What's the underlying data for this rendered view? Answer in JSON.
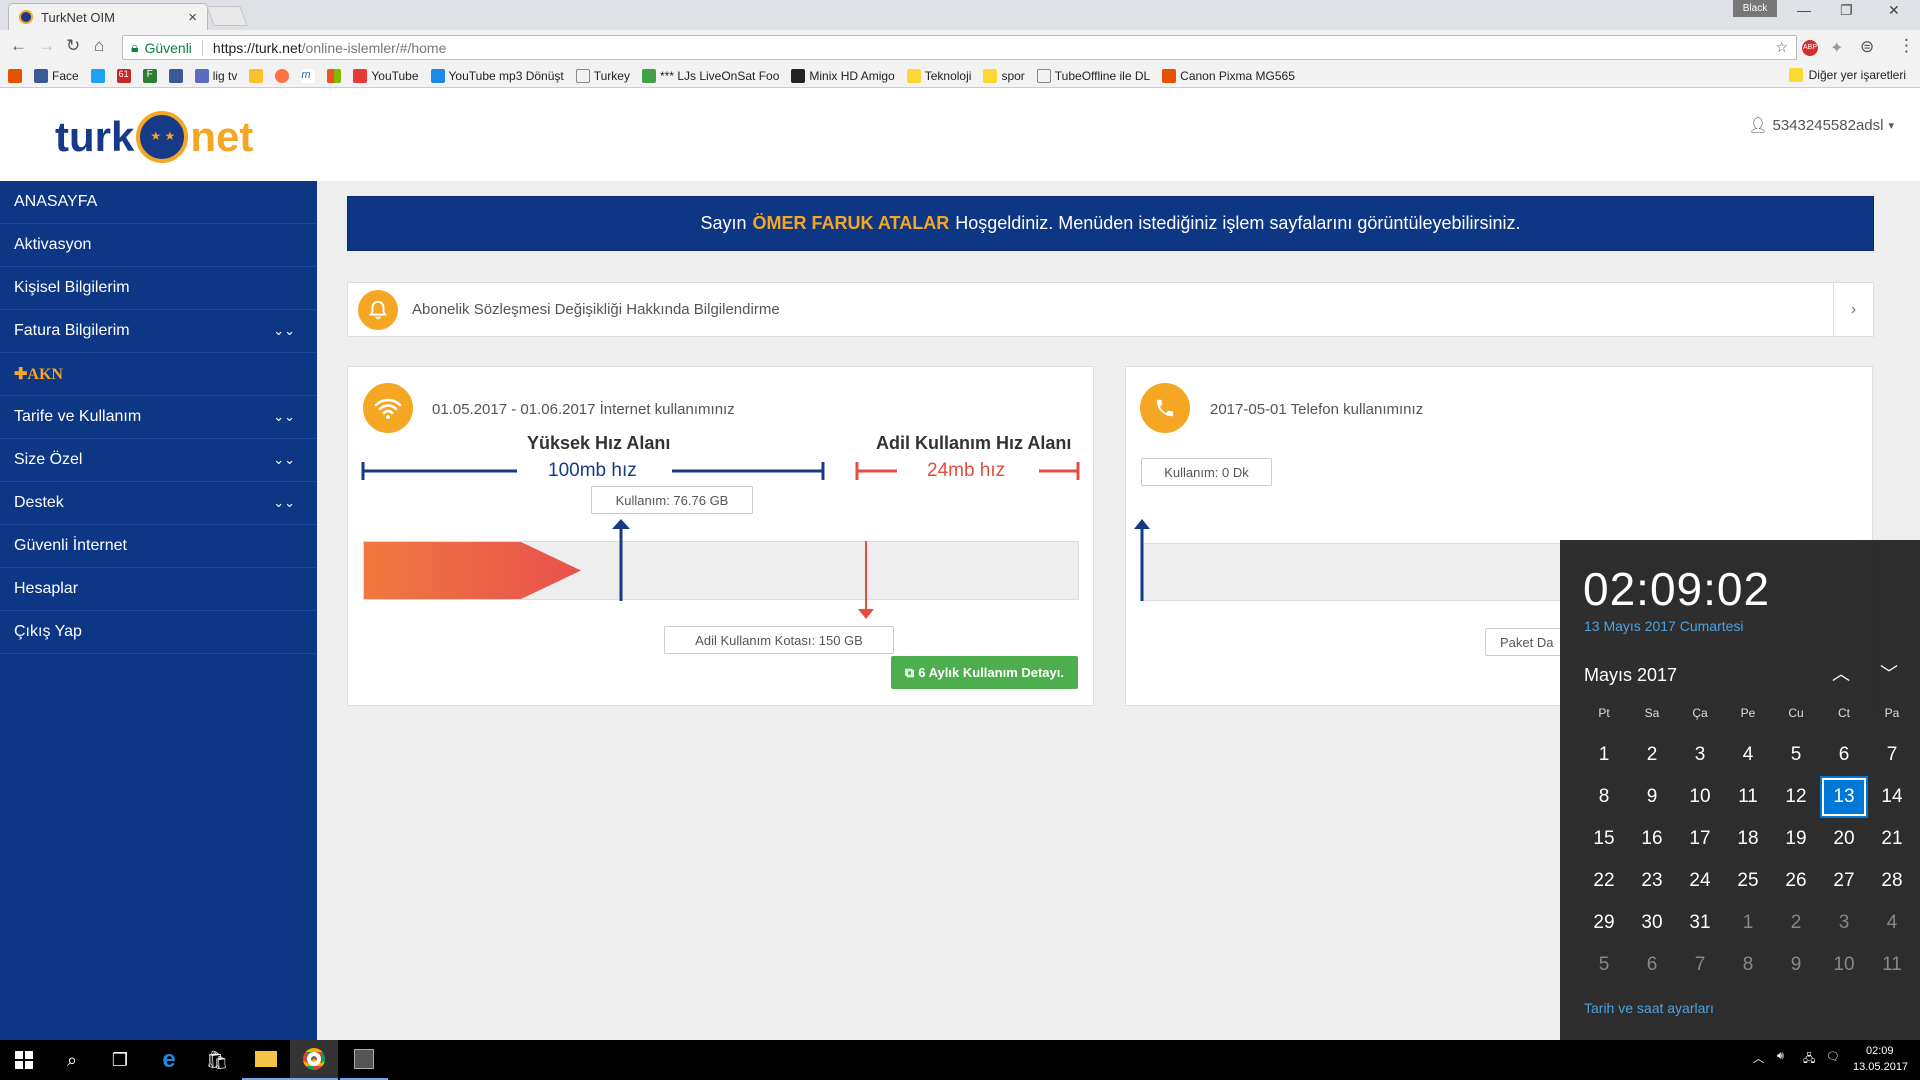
{
  "browser": {
    "tab_title": "TurkNet OIM",
    "profile": "Black",
    "security_label": "Güvenli",
    "url_domain": "https://turk.net",
    "url_path": "/online-islemler/#/home",
    "bookmarks": [
      "Face",
      "",
      "61",
      "F",
      "",
      "lig tv",
      "",
      "",
      "m",
      "",
      "YouTube",
      "YouTube mp3 Dönüşt",
      "Turkey",
      "*** LJs LiveOnSat Foo",
      "Minix HD Amigo",
      "Teknoloji",
      "spor",
      "TubeOffline ile DL",
      "Canon Pixma MG565"
    ],
    "other_bookmarks": "Diğer yer işaretleri"
  },
  "header": {
    "logo_left": "turk",
    "logo_right": "net",
    "username": "5343245582adsl"
  },
  "sidebar": {
    "items": [
      {
        "label": "ANASAYFA",
        "chevron": false
      },
      {
        "label": "Aktivasyon",
        "chevron": false
      },
      {
        "label": "Kişisel Bilgilerim",
        "chevron": false
      },
      {
        "label": "Fatura Bilgilerim",
        "chevron": true
      },
      {
        "label": "✚AKN",
        "chevron": false
      },
      {
        "label": "Tarife ve Kullanım",
        "chevron": true
      },
      {
        "label": "Size Özel",
        "chevron": true
      },
      {
        "label": "Destek",
        "chevron": true
      },
      {
        "label": "Güvenli İnternet",
        "chevron": false
      },
      {
        "label": "Hesaplar",
        "chevron": false
      },
      {
        "label": "Çıkış Yap",
        "chevron": false
      }
    ]
  },
  "welcome": {
    "prefix": "Sayın",
    "name": "ÖMER FARUK ATALAR",
    "suffix": "Hoşgeldiniz. Menüden istediğiniz işlem sayfalarını görüntüleyebilirsiniz."
  },
  "notice": {
    "text": "Abonelik Sözleşmesi Değişikliği Hakkında Bilgilendirme"
  },
  "internet_card": {
    "title": "01.05.2017 - 01.06.2017 İnternet kullanımınız",
    "high_speed_title": "Yüksek Hız Alanı",
    "high_speed": "100mb hız",
    "fair_title": "Adil Kullanım Hız Alanı",
    "fair_speed": "24mb hız",
    "usage_label": "Kullanım: 76.76 GB",
    "quota_label": "Adil Kullanım Kotası: 150 GB",
    "usage_fraction": 0.5117,
    "detail_button": "6 Aylık Kullanım Detayı."
  },
  "phone_card": {
    "title": "2017-05-01 Telefon kullanımınız",
    "usage_label": "Kullanım: 0 Dk",
    "package_label": "Paket Da"
  },
  "calendar": {
    "time": "02:09:02",
    "date": "13 Mayıs 2017 Cumartesi",
    "month": "Mayıs 2017",
    "weekdays": [
      "Pt",
      "Sa",
      "Ça",
      "Pe",
      "Cu",
      "Ct",
      "Pa"
    ],
    "days": [
      "1",
      "2",
      "3",
      "4",
      "5",
      "6",
      "7",
      "8",
      "9",
      "10",
      "11",
      "12",
      "13",
      "14",
      "15",
      "16",
      "17",
      "18",
      "19",
      "20",
      "21",
      "22",
      "23",
      "24",
      "25",
      "26",
      "27",
      "28",
      "29",
      "30",
      "31",
      "1",
      "2",
      "3",
      "4",
      "5",
      "6",
      "7",
      "8",
      "9",
      "10",
      "11"
    ],
    "today": "13",
    "settings_link": "Tarih ve saat ayarları"
  },
  "taskbar": {
    "clock_time": "02:09",
    "clock_date": "13.05.2017"
  }
}
